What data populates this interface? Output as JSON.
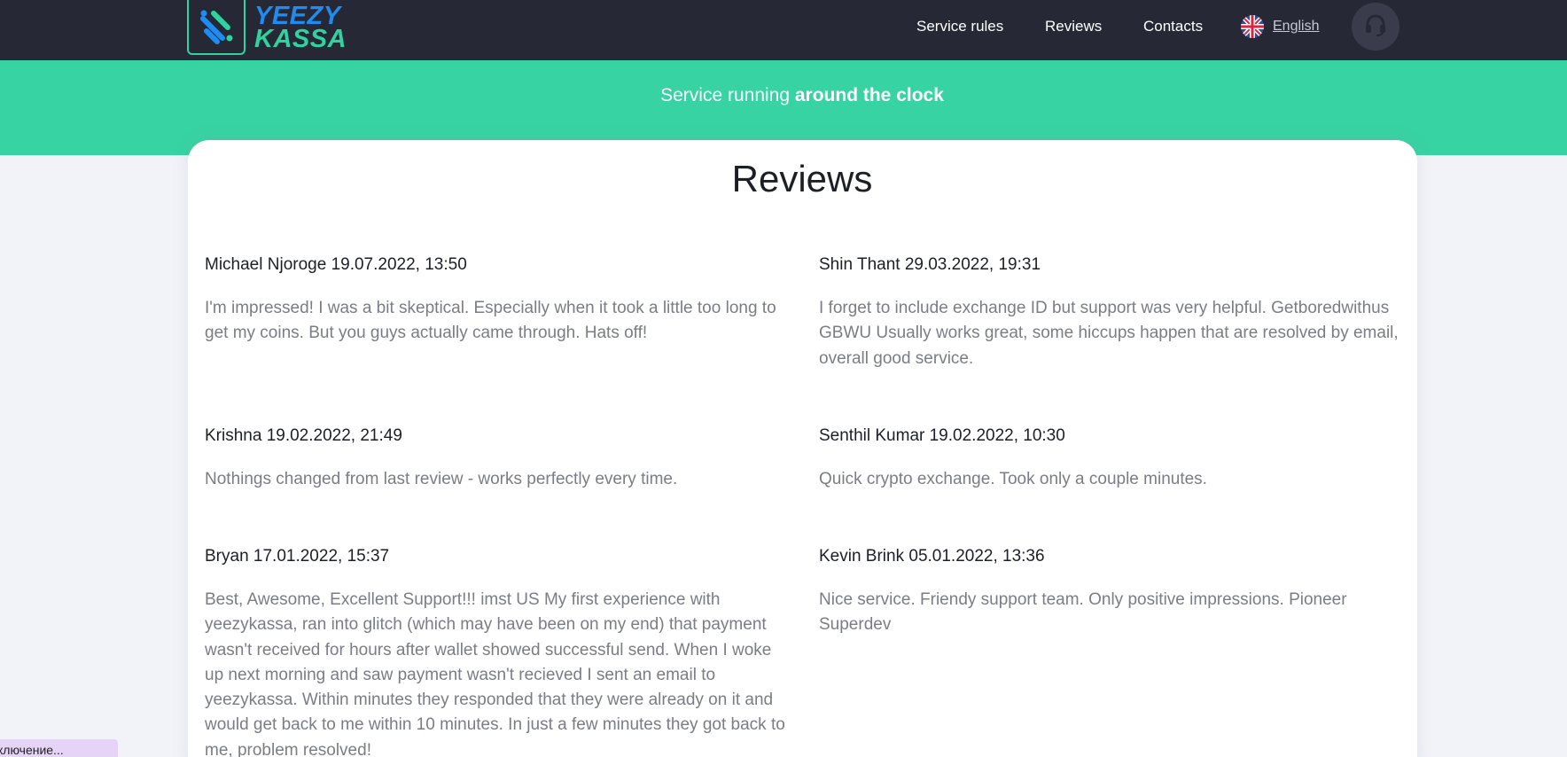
{
  "brand": {
    "line1": "YEEZY",
    "line2": "KASSA",
    "logo_icon": "yeezykassa-logo-icon"
  },
  "nav": {
    "service_rules": "Service rules",
    "reviews": "Reviews",
    "contacts": "Contacts",
    "language": "English",
    "language_icon": "uk-flag-icon",
    "support_icon": "headset-icon"
  },
  "banner": {
    "prefix": "Service running ",
    "emphasis": "around the clock"
  },
  "page_title": "Reviews",
  "reviews": [
    {
      "header": "Michael Njoroge 19.07.2022, 13:50",
      "text": "I'm impressed! I was a bit skeptical. Especially when it took a little too long to get my coins. But you guys actually came through. Hats off!"
    },
    {
      "header": "Shin Thant 29.03.2022, 19:31",
      "text": "I forget to include exchange ID but support was very helpful. Getboredwithus GBWU Usually works great, some hiccups happen that are resolved by email, overall good service."
    },
    {
      "header": "Krishna 19.02.2022, 21:49",
      "text": "Nothings changed from last review - works perfectly every time."
    },
    {
      "header": "Senthil Kumar 19.02.2022, 10:30",
      "text": "Quick crypto exchange. Took only a couple minutes."
    },
    {
      "header": "Bryan 17.01.2022, 15:37",
      "text": "Best, Awesome, Excellent Support!!! imst US My first experience with yeezykassa, ran into glitch (which may have been on my end) that payment wasn't received for hours after wallet showed successful send. When I woke up next morning and saw payment wasn't recieved I sent an email to yeezykassa. Within minutes they responded that they were already on it and would get back to me within 10 minutes. In just a few minutes they got back to me, problem resolved!"
    },
    {
      "header": "Kevin Brink 05.01.2022, 13:36",
      "text": "Nice service. Friendy support team. Only positive impressions. Pioneer Superdev"
    }
  ],
  "status_chip": "ключение..."
}
